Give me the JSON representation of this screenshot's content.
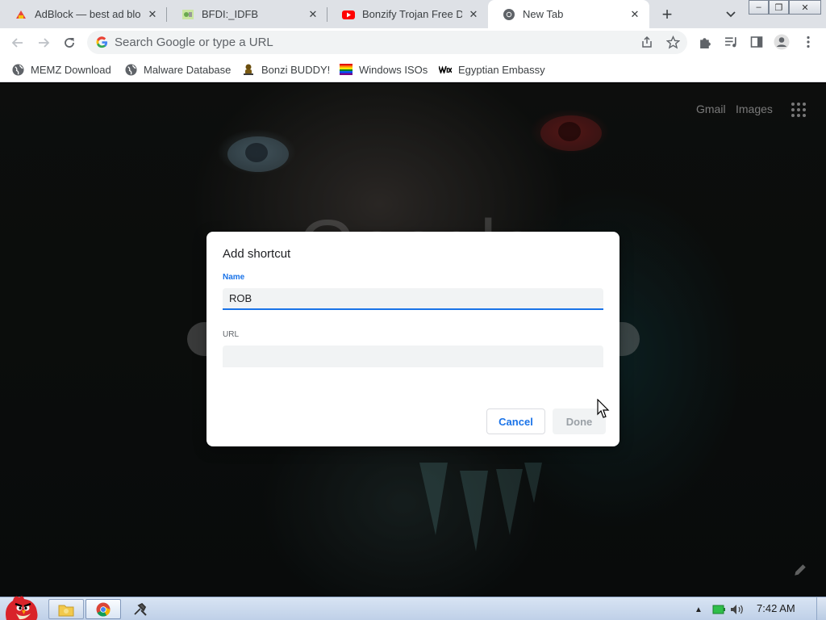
{
  "browser": {
    "tabs": [
      {
        "title": "AdBlock — best ad blocker",
        "icon": "adblock-icon",
        "active": false
      },
      {
        "title": "BFDI:_IDFB",
        "icon": "bfdi-icon",
        "active": false
      },
      {
        "title": "Bonzify Trojan Free Download",
        "icon": "youtube-icon",
        "active": false
      },
      {
        "title": "New Tab",
        "icon": "chrome-icon",
        "active": true
      }
    ],
    "new_tab_label": "+",
    "omnibox": {
      "placeholder": "Search Google or type a URL",
      "value": ""
    },
    "bookmarks": [
      {
        "label": "MEMZ Download",
        "icon": "globe-icon"
      },
      {
        "label": "Malware Database",
        "icon": "globe-icon"
      },
      {
        "label": "Bonzi BUDDY!",
        "icon": "bonzi-icon"
      },
      {
        "label": "Windows ISOs",
        "icon": "rainbow-flag-icon"
      },
      {
        "label": "Egyptian Embassy",
        "icon": "wix-icon"
      }
    ],
    "window_controls": {
      "minimize": "–",
      "restore": "❐",
      "close": "✕"
    }
  },
  "newtab": {
    "links": {
      "gmail": "Gmail",
      "images": "Images"
    },
    "logo_text": "Google"
  },
  "dialog": {
    "title": "Add shortcut",
    "name_label": "Name",
    "name_value": "ROB",
    "url_label": "URL",
    "url_value": "",
    "cancel_label": "Cancel",
    "done_label": "Done"
  },
  "taskbar": {
    "clock": "7:42 AM",
    "tray_up_arrow": "▲"
  },
  "colors": {
    "accent": "#1a73e8",
    "tabstrip_bg": "#dee1e6",
    "taskbar_bg": "#c8d8ee"
  }
}
